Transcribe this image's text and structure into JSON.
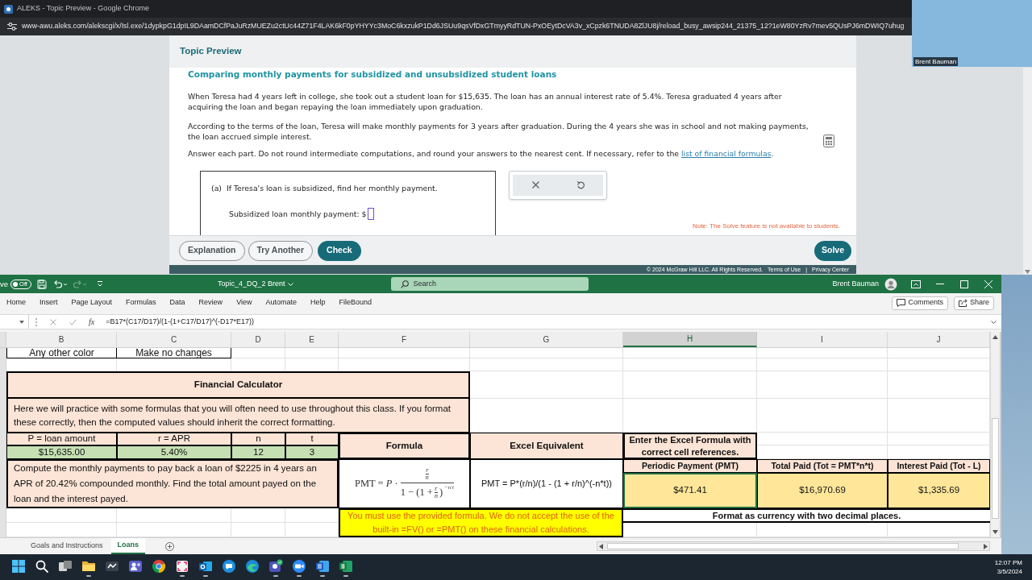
{
  "browser": {
    "title": "ALEKS - Topic Preview - Google Chrome",
    "url": "www-awu.aleks.com/alekscgi/x/Isl.exe/1dypkpG1dpIL9DAamDCfPaJuRzMUEZu2ctUc44Z71F4LAK6kF0pYHYYc3MoC6kxzukP1Dd6JSUu9qsVfDxGTmyyRdTUN-PxOEytDcVA3v_xCpzk6TNUDA8ZlJU8j/reload_busy_awsip244_21375_12?1eW80YzRv7mev5QUsPJ6mDWIQ7uhug"
  },
  "webcam": {
    "name": "Brent Bauman"
  },
  "aleks": {
    "header": "Topic Preview",
    "title": "Comparing monthly payments for subsidized and unsubsidized student loans",
    "paragraphs": [
      {
        "text": "When Teresa had 4 years left in college, she took out a student loan for $15,635. The loan has an annual interest rate of 5.4%. Teresa graduated 4 years after acquiring the loan and began repaying the loan immediately upon graduation."
      },
      {
        "text": "According to the terms of the loan, Teresa will make monthly payments for 3 years after graduation. During the 4 years she was in school and not making payments, the loan accrued simple interest."
      },
      {
        "text": "Answer each part. Do not round intermediate computations, and round your answers to the nearest cent. If necessary, refer to the",
        "link": "list of financial formulas",
        "after": "."
      }
    ],
    "part": {
      "label": "(a)",
      "question": "If Teresa's loan is subsidized, find her monthly payment.",
      "prompt": "Subsidized loan monthly payment: $"
    },
    "tools": [
      {
        "kind": "clear"
      },
      {
        "kind": "undo"
      }
    ],
    "note": "Note: The Solve feature is not available to students.",
    "buttons": [
      {
        "label": "Explanation",
        "kind": "outline"
      },
      {
        "label": "Try Another",
        "kind": "outline"
      },
      {
        "label": "Check",
        "kind": "primary"
      }
    ],
    "solve_button": "Solve",
    "footer": {
      "copyright": "© 2024 McGraw Hill LLC. All Rights Reserved.",
      "links": [
        "Terms of Use",
        "Privacy Center"
      ],
      "separator": "|"
    }
  },
  "excel": {
    "autosave": {
      "label": "ve",
      "on": false,
      "state": "Off"
    },
    "quick_access": [
      {
        "kind": "save",
        "disabled": false
      },
      {
        "kind": "undo",
        "disabled": false
      },
      {
        "kind": "redo",
        "disabled": true
      },
      {
        "kind": "customize",
        "disabled": false
      }
    ],
    "file_name": "Topic_4_DQ_2 Brent",
    "search": {
      "placeholder": "Search"
    },
    "user": "Brent Bauman",
    "window_controls": [
      {
        "kind": "ribbon_display"
      },
      {
        "kind": "minimize"
      },
      {
        "kind": "maximize"
      },
      {
        "kind": "close"
      }
    ],
    "menu": [
      "Home",
      "Insert",
      "Page Layout",
      "Formulas",
      "Data",
      "Review",
      "View",
      "Automate",
      "Help",
      "FileBound"
    ],
    "menu_buttons": [
      {
        "label": "Comments",
        "kind": "comments"
      },
      {
        "label": "Share",
        "kind": "share"
      }
    ],
    "function_button": "fx",
    "formula": "=B17*(C17/D17)/(1-(1+C17/D17)^(-D17*E17))",
    "columns": [
      {
        "label": "B",
        "selected": false
      },
      {
        "label": "C",
        "selected": false
      },
      {
        "label": "D",
        "selected": false
      },
      {
        "label": "E",
        "selected": false
      },
      {
        "label": "F",
        "selected": false
      },
      {
        "label": "G",
        "selected": false
      },
      {
        "label": "H",
        "selected": true
      },
      {
        "label": "I",
        "selected": false
      },
      {
        "label": "J",
        "selected": false
      }
    ],
    "sheet": {
      "legend_row": [
        "Any other color",
        "Make no changes"
      ],
      "calculator": {
        "title": "Financial Calculator",
        "intro": "Here we will practice with some formulas that you will often need to use throughout this class. If you format these correctly, then the computed values should inherit the correct formatting.",
        "variables": [
          {
            "label": "P = loan amount",
            "value": "$15,635.00"
          },
          {
            "label": "r = APR",
            "value": "5.40%"
          },
          {
            "label": "n",
            "value": "12"
          },
          {
            "label": "t",
            "value": "3"
          }
        ],
        "formula_header": "Formula",
        "excel_header": "Excel Equivalent",
        "entry_header": "Enter the Excel Formula with correct cell references.",
        "problem": "Compute the monthly payments to pay back a loan of $2225 in 4 years an APR of 20.42% compounded monthly. Find the total amount payed on the loan and the interest payed.",
        "formula": {
          "lhs": "PMT = *P* ·",
          "numerator": {
            "top": "r",
            "bottom": "n"
          },
          "denominator": {
            "before": "1 − (1 +",
            "fraction": {
              "top": "r",
              "bottom": "n"
            },
            "after": ")",
            "exponent": "−n·t"
          }
        },
        "excel_formula": "PMT = P*(r/n)/(1 - (1 + r/n)^(-n*t))",
        "results": [
          {
            "label": "Periodic Payment (PMT)",
            "value": "$471.41",
            "selected": true
          },
          {
            "label": "Total Paid (Tot = PMT*n*t)",
            "value": "$16,970.69",
            "selected": false
          },
          {
            "label": "Interest Paid (Tot - L)",
            "value": "$1,335.69",
            "selected": false
          }
        ],
        "warning": "You must use the provided formula. We do not accept the use of the built-in =FV() or =PMT() on these financial calculations.",
        "format_note": "Format as currency with two decimal places."
      }
    },
    "sheet_tabs": [
      {
        "label": "Goals and Instructions",
        "selected": false
      },
      {
        "label": "Loans",
        "selected": true
      }
    ]
  },
  "taskbar": {
    "apps": [
      {
        "kind": "start",
        "running": false
      },
      {
        "kind": "search",
        "running": false
      },
      {
        "kind": "task_view",
        "running": false
      },
      {
        "kind": "file_explorer",
        "running": true
      },
      {
        "kind": "pen_app",
        "running": false
      },
      {
        "kind": "teams",
        "running": false
      },
      {
        "kind": "chrome",
        "running": false
      },
      {
        "kind": "snip",
        "running": true
      },
      {
        "kind": "outlook",
        "running": true
      },
      {
        "kind": "chat",
        "running": false
      },
      {
        "kind": "edge",
        "running": false
      },
      {
        "kind": "teams_new",
        "running": true
      },
      {
        "kind": "zoom",
        "running": true
      },
      {
        "kind": "word",
        "running": true
      },
      {
        "kind": "excel",
        "running": true
      }
    ],
    "time": "12:07 PM",
    "date": "3/5/2024"
  }
}
